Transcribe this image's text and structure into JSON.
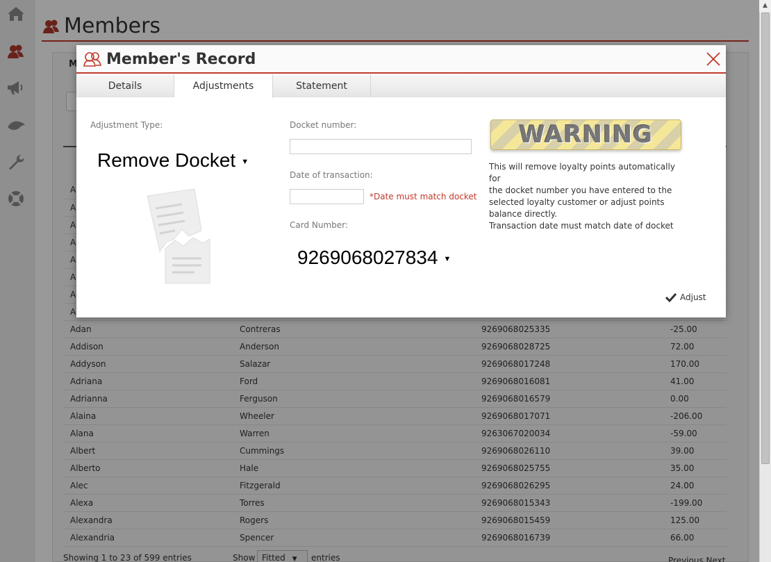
{
  "page": {
    "title": "Members",
    "panel_tab": "M"
  },
  "sidebar": {
    "items": [
      {
        "name": "home-icon"
      },
      {
        "name": "members-icon"
      },
      {
        "name": "megaphone-icon"
      },
      {
        "name": "bird-icon"
      },
      {
        "name": "wrench-icon"
      },
      {
        "name": "lifebuoy-icon"
      }
    ]
  },
  "modal": {
    "title": "Member's Record",
    "tabs": [
      "Details",
      "Adjustments",
      "Statement"
    ],
    "active_tab": "Adjustments",
    "adjustment_type_label": "Adjustment Type:",
    "adjustment_type_value": "Remove Docket",
    "docket_number_label": "Docket number:",
    "docket_number_value": "",
    "date_label": "Date of transaction:",
    "date_value": "",
    "date_warning": "*Date must match docket",
    "card_number_label": "Card Number:",
    "card_number_value": "9269068027834",
    "warning_badge": "WARNING",
    "warning_lines": [
      "This will remove loyalty points automatically for",
      "the docket number you have entered to the",
      "selected loyalty customer or adjust points",
      "balance directly.",
      "Transaction date must match date of docket"
    ],
    "adjust_label": "Adjust"
  },
  "table": {
    "rows": [
      [
        "A",
        "",
        "",
        ""
      ],
      [
        "A",
        "",
        "",
        ""
      ],
      [
        "A",
        "",
        "",
        ""
      ],
      [
        "A",
        "",
        "",
        ""
      ],
      [
        "A",
        "",
        "",
        ""
      ],
      [
        "A",
        "",
        "",
        ""
      ],
      [
        "A",
        "",
        "",
        ""
      ],
      [
        "A",
        "",
        "",
        ""
      ],
      [
        "Adan",
        "Contreras",
        "9269068025335",
        "-25.00"
      ],
      [
        "Addison",
        "Anderson",
        "9269068028725",
        "72.00"
      ],
      [
        "Addyson",
        "Salazar",
        "9269068017248",
        "170.00"
      ],
      [
        "Adriana",
        "Ford",
        "9269068016081",
        "41.00"
      ],
      [
        "Adrianna",
        "Ferguson",
        "9269068016579",
        "0.00"
      ],
      [
        "Alaina",
        "Wheeler",
        "9269068017071",
        "-206.00"
      ],
      [
        "Alana",
        "Warren",
        "9263067020034",
        "-59.00"
      ],
      [
        "Albert",
        "Cummings",
        "9269068026110",
        "39.00"
      ],
      [
        "Alberto",
        "Hale",
        "9269068025755",
        "35.00"
      ],
      [
        "Alec",
        "Fitzgerald",
        "9269068026295",
        "24.00"
      ],
      [
        "Alexa",
        "Torres",
        "9269068015343",
        "-199.00"
      ],
      [
        "Alexandra",
        "Rogers",
        "9269068015459",
        "125.00"
      ],
      [
        "Alexandria",
        "Spencer",
        "9269068016739",
        "66.00"
      ]
    ]
  },
  "footer": {
    "info": "Showing 1 to 23 of 599 entries",
    "show_label": "Show",
    "page_size": "Fitted",
    "entries_label": "entries",
    "pager": "Previous  Next"
  },
  "colors": {
    "accent": "#c0392b",
    "warning_text": "#c0392b"
  }
}
